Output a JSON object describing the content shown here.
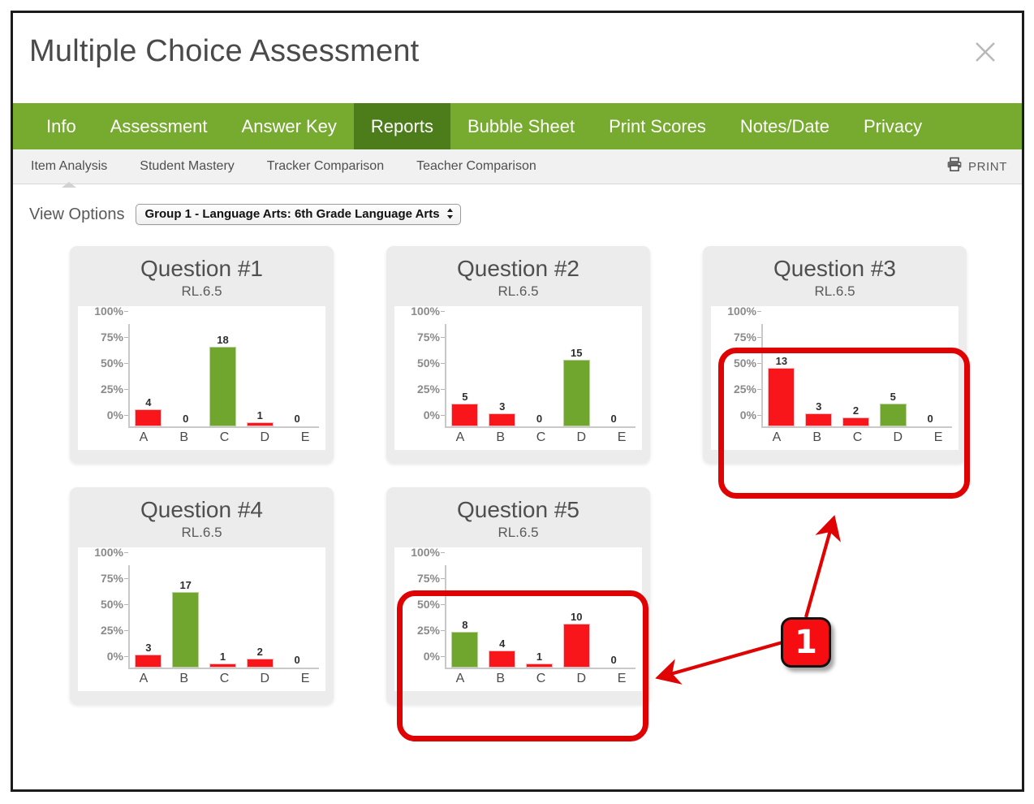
{
  "window": {
    "title": "Multiple Choice Assessment",
    "close_icon": "close-icon"
  },
  "main_nav": {
    "items": [
      {
        "label": "Info",
        "active": false
      },
      {
        "label": "Assessment",
        "active": false
      },
      {
        "label": "Answer Key",
        "active": false
      },
      {
        "label": "Reports",
        "active": true
      },
      {
        "label": "Bubble Sheet",
        "active": false
      },
      {
        "label": "Print Scores",
        "active": false
      },
      {
        "label": "Notes/Date",
        "active": false
      },
      {
        "label": "Privacy",
        "active": false
      }
    ],
    "active_color": "#4d7c1b",
    "bar_color": "#76ab2f"
  },
  "sub_nav": {
    "items": [
      {
        "label": "Item Analysis",
        "active": true
      },
      {
        "label": "Student Mastery",
        "active": false
      },
      {
        "label": "Tracker Comparison",
        "active": false
      },
      {
        "label": "Teacher Comparison",
        "active": false
      }
    ],
    "print": {
      "label": "PRINT",
      "icon": "printer-icon"
    }
  },
  "view_options": {
    "label": "View Options",
    "selected": "Group 1 - Language Arts: 6th Grade Language Arts",
    "stepper_glyph": "↕"
  },
  "chart_data": [
    {
      "type": "bar",
      "title": "Question #1",
      "subtitle": "RL.6.5",
      "categories": [
        "A",
        "B",
        "C",
        "D",
        "E"
      ],
      "values": [
        4,
        0,
        18,
        1,
        0
      ],
      "percents": [
        17,
        0,
        78,
        4,
        0
      ],
      "colors": [
        "red",
        "none",
        "green",
        "red",
        "none"
      ],
      "correct_answer": "C",
      "xlabel": "",
      "ylabel": "",
      "yticks": [
        "0%",
        "25%",
        "50%",
        "75%",
        "100%"
      ],
      "ylim": [
        0,
        100
      ],
      "grid": false,
      "legend": "none"
    },
    {
      "type": "bar",
      "title": "Question #2",
      "subtitle": "RL.6.5",
      "categories": [
        "A",
        "B",
        "C",
        "D",
        "E"
      ],
      "values": [
        5,
        3,
        0,
        15,
        0
      ],
      "percents": [
        22,
        13,
        0,
        65,
        0
      ],
      "colors": [
        "red",
        "red",
        "none",
        "green",
        "none"
      ],
      "correct_answer": "D",
      "xlabel": "",
      "ylabel": "",
      "yticks": [
        "0%",
        "25%",
        "50%",
        "75%",
        "100%"
      ],
      "ylim": [
        0,
        100
      ],
      "grid": false,
      "legend": "none"
    },
    {
      "type": "bar",
      "title": "Question #3",
      "subtitle": "RL.6.5",
      "categories": [
        "A",
        "B",
        "C",
        "D",
        "E"
      ],
      "values": [
        13,
        3,
        2,
        5,
        0
      ],
      "percents": [
        57,
        13,
        9,
        22,
        0
      ],
      "colors": [
        "red",
        "red",
        "red",
        "green",
        "none"
      ],
      "correct_answer": "D",
      "xlabel": "",
      "ylabel": "",
      "yticks": [
        "0%",
        "25%",
        "50%",
        "75%",
        "100%"
      ],
      "ylim": [
        0,
        100
      ],
      "grid": false,
      "legend": "none",
      "highlighted": true
    },
    {
      "type": "bar",
      "title": "Question #4",
      "subtitle": "RL.6.5",
      "categories": [
        "A",
        "B",
        "C",
        "D",
        "E"
      ],
      "values": [
        3,
        17,
        1,
        2,
        0
      ],
      "percents": [
        13,
        74,
        4,
        9,
        0
      ],
      "colors": [
        "red",
        "green",
        "red",
        "red",
        "none"
      ],
      "correct_answer": "B",
      "xlabel": "",
      "ylabel": "",
      "yticks": [
        "0%",
        "25%",
        "50%",
        "75%",
        "100%"
      ],
      "ylim": [
        0,
        100
      ],
      "grid": false,
      "legend": "none"
    },
    {
      "type": "bar",
      "title": "Question #5",
      "subtitle": "RL.6.5",
      "categories": [
        "A",
        "B",
        "C",
        "D",
        "E"
      ],
      "values": [
        8,
        4,
        1,
        10,
        0
      ],
      "percents": [
        35,
        17,
        4,
        43,
        0
      ],
      "colors": [
        "green",
        "red",
        "red",
        "red",
        "none"
      ],
      "correct_answer": "A",
      "xlabel": "",
      "ylabel": "",
      "yticks": [
        "0%",
        "25%",
        "50%",
        "75%",
        "100%"
      ],
      "ylim": [
        0,
        100
      ],
      "grid": false,
      "legend": "none",
      "highlighted": true
    }
  ],
  "annotations": {
    "badge_label": "1",
    "accent_color": "#e00303",
    "targets": [
      "Question #3",
      "Question #5"
    ]
  }
}
